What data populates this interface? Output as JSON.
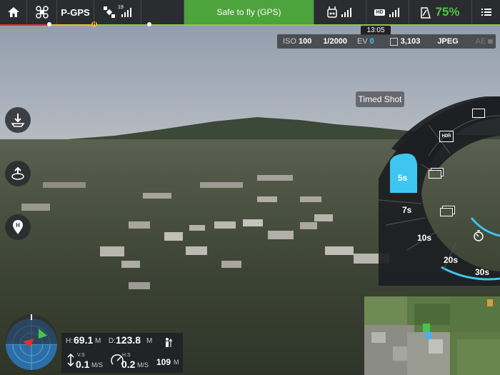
{
  "topbar": {
    "flight_mode": "P-GPS",
    "satellite_count": "19",
    "status_text": "Safe to fly (GPS)",
    "hd_label": "HD",
    "battery_percent": "75%"
  },
  "time_display": "13:05",
  "camera_settings": {
    "iso_label": "ISO",
    "iso_value": "100",
    "shutter": "1/2000",
    "ev_label": "EV",
    "ev_value": "0",
    "remaining_shots": "3,103",
    "format": "JPEG",
    "ae_label": "AE"
  },
  "tooltip": "Timed Shot",
  "dial": {
    "modes": [
      "single-shot-icon",
      "hdr-icon",
      "burst-icon",
      "aeb-icon",
      "timer-icon"
    ],
    "hdr_label": "HDR",
    "intervals": [
      "5s",
      "7s",
      "10s",
      "20s",
      "30s"
    ],
    "selected": "5s",
    "accent_color": "#3ec6f0"
  },
  "telemetry": {
    "h_label": "H:",
    "h_value": "69.1",
    "h_unit": "M",
    "d_label": "D:",
    "d_value": "123.8",
    "d_unit": "M",
    "vs_label": "V.S",
    "vs_value": "0.1",
    "vs_unit": "M/S",
    "hs_label": "H.S",
    "hs_value": "0.2",
    "hs_unit": "M/S",
    "altitude_value": "109",
    "altitude_unit": "M"
  },
  "colors": {
    "topbar_bg": "#2a2c2f",
    "safe_green": "#4da33c",
    "battery_green": "#4fc34f",
    "accent_blue": "#3ec6f0"
  }
}
